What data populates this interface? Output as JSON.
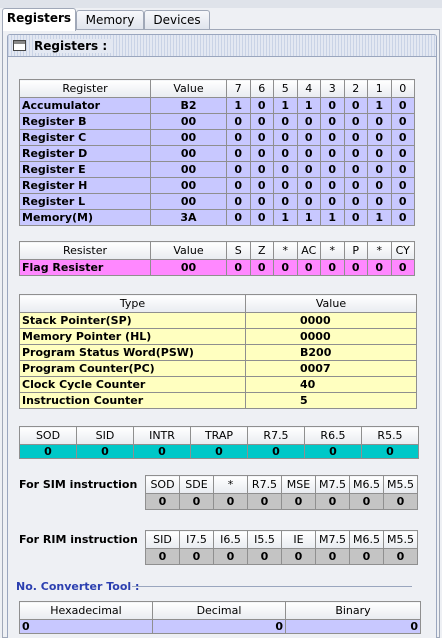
{
  "tabs": [
    "Registers",
    "Memory",
    "Devices"
  ],
  "panel_title": "Registers :",
  "registers": {
    "headers": [
      "Register",
      "Value",
      "7",
      "6",
      "5",
      "4",
      "3",
      "2",
      "1",
      "0"
    ],
    "rows": [
      {
        "name": "Accumulator",
        "value": "B2",
        "bits": [
          "1",
          "0",
          "1",
          "1",
          "0",
          "0",
          "1",
          "0"
        ]
      },
      {
        "name": "Register B",
        "value": "00",
        "bits": [
          "0",
          "0",
          "0",
          "0",
          "0",
          "0",
          "0",
          "0"
        ]
      },
      {
        "name": "Register C",
        "value": "00",
        "bits": [
          "0",
          "0",
          "0",
          "0",
          "0",
          "0",
          "0",
          "0"
        ]
      },
      {
        "name": "Register D",
        "value": "00",
        "bits": [
          "0",
          "0",
          "0",
          "0",
          "0",
          "0",
          "0",
          "0"
        ]
      },
      {
        "name": "Register E",
        "value": "00",
        "bits": [
          "0",
          "0",
          "0",
          "0",
          "0",
          "0",
          "0",
          "0"
        ]
      },
      {
        "name": "Register H",
        "value": "00",
        "bits": [
          "0",
          "0",
          "0",
          "0",
          "0",
          "0",
          "0",
          "0"
        ]
      },
      {
        "name": "Register L",
        "value": "00",
        "bits": [
          "0",
          "0",
          "0",
          "0",
          "0",
          "0",
          "0",
          "0"
        ]
      },
      {
        "name": "Memory(M)",
        "value": "3A",
        "bits": [
          "0",
          "0",
          "1",
          "1",
          "1",
          "0",
          "1",
          "0"
        ]
      }
    ]
  },
  "flags": {
    "headers": [
      "Resister",
      "Value",
      "S",
      "Z",
      "*",
      "AC",
      "*",
      "P",
      "*",
      "CY"
    ],
    "row": {
      "name": "Flag Resister",
      "value": "00",
      "bits": [
        "0",
        "0",
        "0",
        "0",
        "0",
        "0",
        "0",
        "0"
      ]
    }
  },
  "pointers": {
    "headers": [
      "Type",
      "Value"
    ],
    "rows": [
      {
        "type": "Stack Pointer(SP)",
        "value": "0000"
      },
      {
        "type": "Memory Pointer (HL)",
        "value": "0000"
      },
      {
        "type": "Program Status Word(PSW)",
        "value": "B200"
      },
      {
        "type": "Program Counter(PC)",
        "value": "0007"
      },
      {
        "type": "Clock Cycle Counter",
        "value": "40"
      },
      {
        "type": "Instruction Counter",
        "value": "5"
      }
    ]
  },
  "interrupts": {
    "headers": [
      "SOD",
      "SID",
      "INTR",
      "TRAP",
      "R7.5",
      "R6.5",
      "R5.5"
    ],
    "values": [
      "0",
      "0",
      "0",
      "0",
      "0",
      "0",
      "0"
    ]
  },
  "sim": {
    "label": "For SIM instruction",
    "headers": [
      "SOD",
      "SDE",
      "*",
      "R7.5",
      "MSE",
      "M7.5",
      "M6.5",
      "M5.5"
    ],
    "values": [
      "0",
      "0",
      "0",
      "0",
      "0",
      "0",
      "0",
      "0"
    ]
  },
  "rim": {
    "label": "For RIM instruction",
    "headers": [
      "SID",
      "I7.5",
      "I6.5",
      "I5.5",
      "IE",
      "M7.5",
      "M6.5",
      "M5.5"
    ],
    "values": [
      "0",
      "0",
      "0",
      "0",
      "0",
      "0",
      "0",
      "0"
    ]
  },
  "converter": {
    "title": "No. Converter Tool :",
    "headers": [
      "Hexadecimal",
      "Decimal",
      "Binary"
    ],
    "values": [
      "0",
      "0",
      "0"
    ]
  }
}
